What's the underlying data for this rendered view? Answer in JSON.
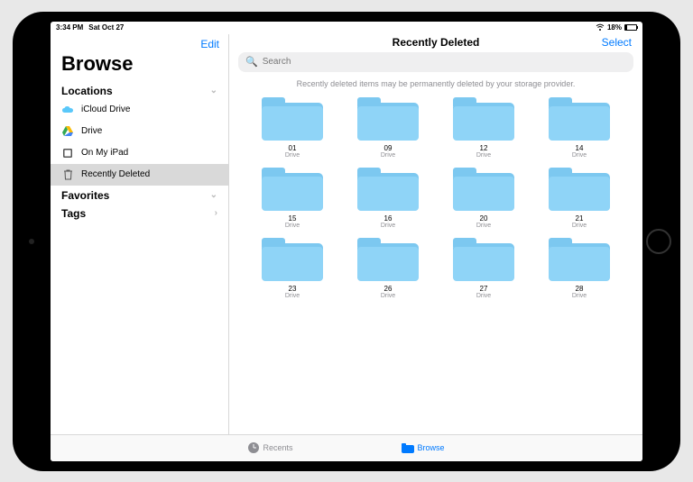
{
  "status": {
    "time": "3:34 PM",
    "date": "Sat Oct 27",
    "battery_pct": "18%",
    "battery_level": 18
  },
  "sidebar": {
    "edit": "Edit",
    "title": "Browse",
    "sections": {
      "locations": "Locations",
      "favorites": "Favorites",
      "tags": "Tags"
    },
    "items": [
      {
        "label": "iCloud Drive",
        "icon": "cloud"
      },
      {
        "label": "Drive",
        "icon": "gdrive"
      },
      {
        "label": "On My iPad",
        "icon": "ipad"
      },
      {
        "label": "Recently Deleted",
        "icon": "trash"
      }
    ]
  },
  "main": {
    "title": "Recently Deleted",
    "select": "Select",
    "search_placeholder": "Search",
    "info": "Recently deleted items may be permanently deleted by your storage provider.",
    "folders": [
      {
        "name": "01",
        "src": "Drive"
      },
      {
        "name": "09",
        "src": "Drive"
      },
      {
        "name": "12",
        "src": "Drive"
      },
      {
        "name": "14",
        "src": "Drive"
      },
      {
        "name": "15",
        "src": "Drive"
      },
      {
        "name": "16",
        "src": "Drive"
      },
      {
        "name": "20",
        "src": "Drive"
      },
      {
        "name": "21",
        "src": "Drive"
      },
      {
        "name": "23",
        "src": "Drive"
      },
      {
        "name": "26",
        "src": "Drive"
      },
      {
        "name": "27",
        "src": "Drive"
      },
      {
        "name": "28",
        "src": "Drive"
      }
    ]
  },
  "tabbar": {
    "recents": "Recents",
    "browse": "Browse"
  }
}
